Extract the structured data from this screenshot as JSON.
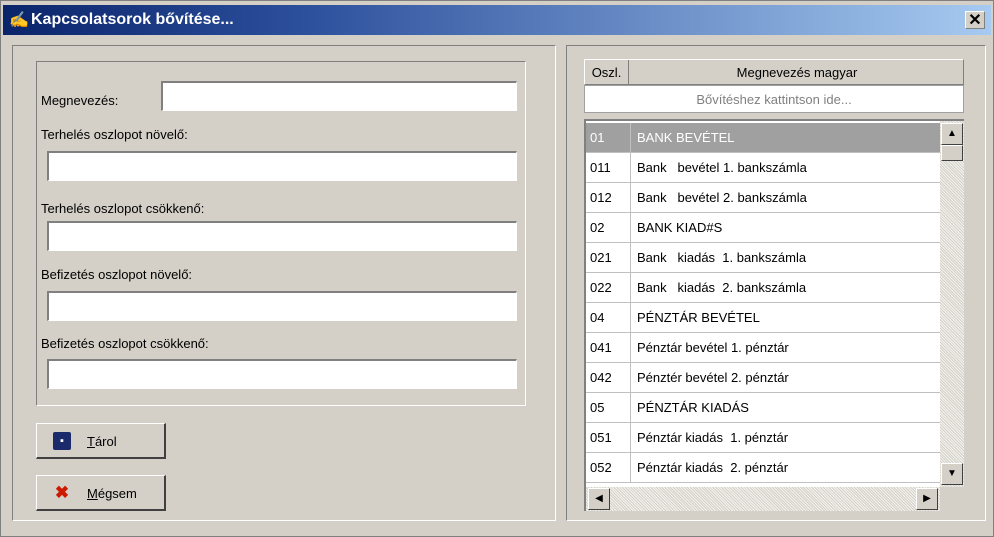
{
  "window": {
    "title": "Kapcsolatsorok bővítése...",
    "close_glyph": "✕"
  },
  "form": {
    "name_label": "Megnevezés:",
    "name_value": "",
    "debit_increase_label": "Terhelés oszlopot növelő:",
    "debit_increase_value": "",
    "debit_decrease_label": "Terhelés oszlopot csökkenő:",
    "debit_decrease_value": "",
    "payment_increase_label": "Befizetés oszlopot növelő:",
    "payment_increase_value": "",
    "payment_decrease_label": "Befizetés oszlopot csökkenő:",
    "payment_decrease_value": ""
  },
  "buttons": {
    "save_underlined": "T",
    "save_rest": "árol",
    "cancel_underlined": "M",
    "cancel_rest": "égsem"
  },
  "grid": {
    "col_code_header": "Oszl.",
    "col_name_header": "Megnevezés magyar",
    "add_row_text": "Bővítéshez kattintson ide...",
    "rows": [
      {
        "code": "01",
        "name": "BANK BEVÉTEL",
        "selected": true
      },
      {
        "code": "011",
        "name": "Bank   bevétel 1. bankszámla"
      },
      {
        "code": "012",
        "name": "Bank   bevétel 2. bankszámla"
      },
      {
        "code": "02",
        "name": "BANK KIAD#S"
      },
      {
        "code": "021",
        "name": "Bank   kiadás  1. bankszámla"
      },
      {
        "code": "022",
        "name": "Bank   kiadás  2. bankszámla"
      },
      {
        "code": "04",
        "name": "PÉNZTÁR BEVÉTEL"
      },
      {
        "code": "041",
        "name": "Pénztár bevétel 1. pénztár"
      },
      {
        "code": "042",
        "name": "Pénztér bevétel 2. pénztár"
      },
      {
        "code": "05",
        "name": "PÉNZTÁR KIADÁS"
      },
      {
        "code": "051",
        "name": "Pénztár kiadás  1. pénztár"
      },
      {
        "code": "052",
        "name": "Pénztár kiadás  2. pénztár"
      }
    ]
  },
  "icons": {
    "app": "gear-pen-icon",
    "save": "floppy-disk-icon",
    "cancel": "red-x-icon"
  },
  "colors": {
    "title_start": "#0a246a",
    "title_end": "#a6caf0",
    "selection": "#a0a0a0",
    "cancel_icon": "#cc1a00"
  }
}
